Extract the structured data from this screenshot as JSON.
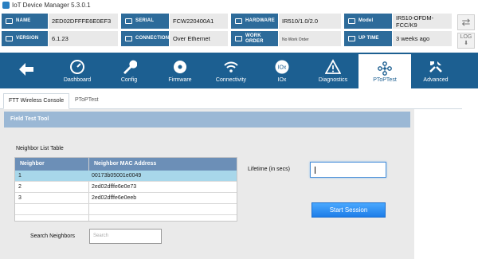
{
  "window": {
    "title": "IoT Device Manager 5.3.0.1"
  },
  "info": {
    "name_label": "NAME",
    "name_value": "2ED02DFFFE6E0EF3",
    "serial_label": "SERIAL",
    "serial_value": "FCW220400A1",
    "hardware_label": "HARDWARE ID",
    "hardware_value": "IR510/1.0/2.0",
    "model_label": "Model",
    "model_value": "IR510-OFDM-FCC/K9",
    "version_label": "VERSION",
    "version_value": "6.1.23",
    "connection_label": "CONNECTION",
    "connection_value": "Over Ethernet",
    "workorder_label": "WORK ORDER",
    "workorder_value": "No Work Order",
    "uptime_label": "UP TIME",
    "uptime_value": "3 weeks ago",
    "log_label": "LOG"
  },
  "nav": {
    "items": [
      {
        "label": "Dashboard",
        "icon": "speedometer-icon"
      },
      {
        "label": "Config",
        "icon": "wrench-icon"
      },
      {
        "label": "Firmware",
        "icon": "cd-disc-icon"
      },
      {
        "label": "Connectivity",
        "icon": "wifi-icon"
      },
      {
        "label": "IOx",
        "icon": "iox-icon",
        "badge": "IOx"
      },
      {
        "label": "Diagnostics",
        "icon": "warning-triangle-icon"
      },
      {
        "label": "PToPTest",
        "icon": "network-molecule-icon"
      },
      {
        "label": "Advanced",
        "icon": "tools-icon"
      }
    ],
    "active": "PToPTest"
  },
  "tabs": [
    {
      "label": "FTT Wireless Console",
      "active": true
    },
    {
      "label": "PToPTest",
      "active": false
    }
  ],
  "panel": {
    "header": "Field Test Tool",
    "neighbor_table_title": "Neighbor List Table",
    "columns": [
      "Neighbor",
      "Neighbor MAC Address"
    ],
    "rows": [
      {
        "neighbor": "1",
        "mac": "00173b05001e0049"
      },
      {
        "neighbor": "2",
        "mac": "2ed02dfffe6e0e73"
      },
      {
        "neighbor": "3",
        "mac": "2ed02dfffe6e0eeb"
      }
    ],
    "selected_row": 1,
    "search_label": "Search Neighbors",
    "search_placeholder": "Search",
    "lifetime_label": "Lifetime (in secs)",
    "lifetime_value": "",
    "start_button": "Start Session"
  },
  "colors": {
    "nav_bg": "#1c5f91",
    "label_bg": "#2d6b9a",
    "panel_header": "#9bb8d5",
    "table_header": "#6c8fb7",
    "selected_row": "#a8d7ea",
    "button": "#1d7de8"
  }
}
